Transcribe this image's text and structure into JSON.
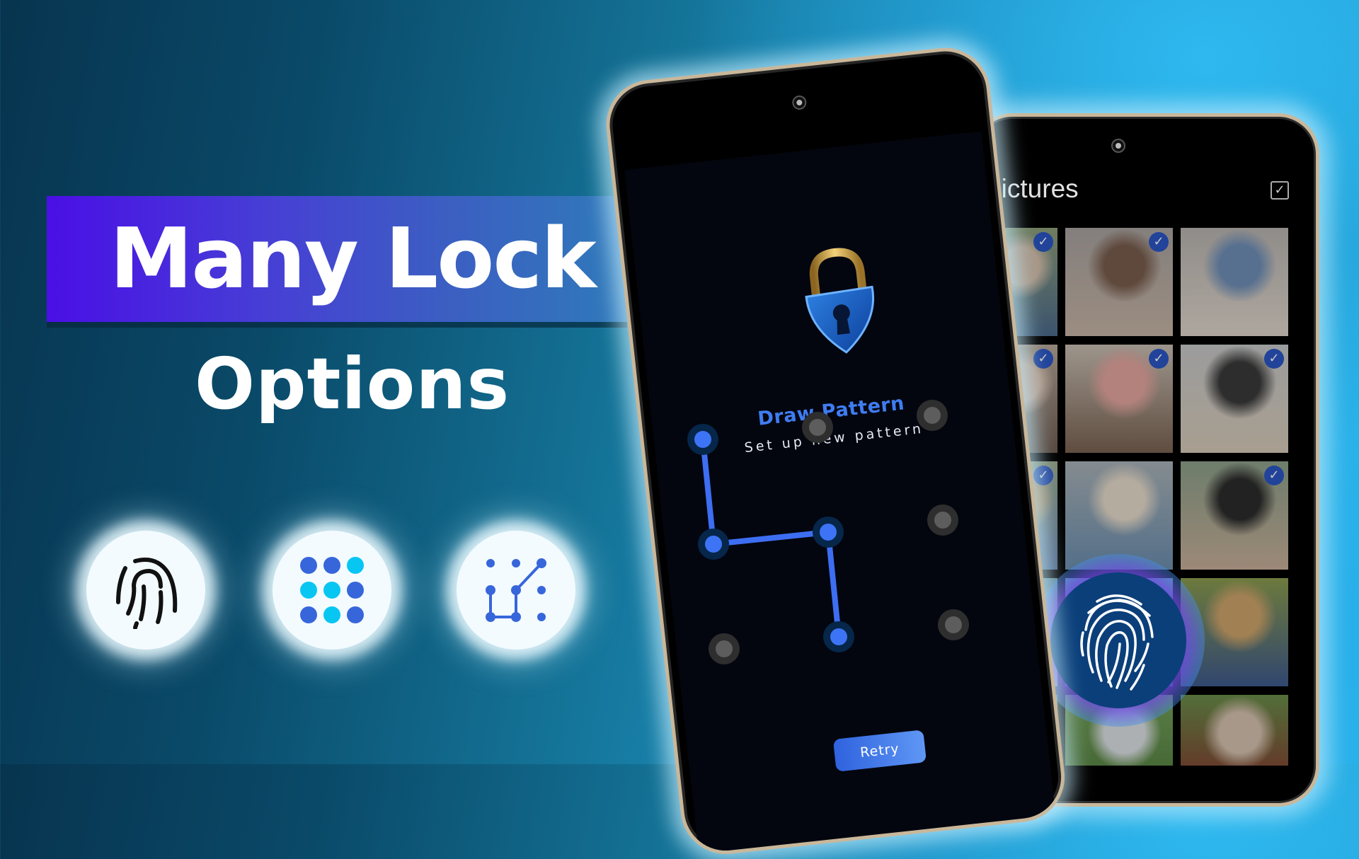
{
  "headline": {
    "line1": "Many Lock",
    "line2": "Options"
  },
  "lock_options": [
    {
      "name": "fingerprint",
      "icon": "fingerprint-icon"
    },
    {
      "name": "pin",
      "icon": "pin-keypad-icon"
    },
    {
      "name": "pattern",
      "icon": "pattern-icon"
    }
  ],
  "front_phone": {
    "screen": "pattern-setup",
    "lock_icon": "padlock-icon",
    "title": "Draw Pattern",
    "subtitle": "Set up new pattern",
    "pattern_grid": {
      "rows": 3,
      "cols": 3,
      "selected_sequence": [
        [
          0,
          0
        ],
        [
          1,
          0
        ],
        [
          1,
          1
        ],
        [
          2,
          1
        ]
      ]
    },
    "retry_label": "Retry"
  },
  "back_phone": {
    "title": "Pictures",
    "select_all_icon": "checkbox-checked-icon",
    "photos": [
      {
        "selected": true
      },
      {
        "selected": true
      },
      {
        "selected": false
      },
      {
        "selected": true
      },
      {
        "selected": true
      },
      {
        "selected": true
      },
      {
        "selected": true
      },
      {
        "selected": false
      },
      {
        "selected": true
      },
      {
        "selected": false
      },
      {
        "selected": false
      },
      {
        "selected": false
      },
      {
        "selected": false
      },
      {
        "selected": false
      },
      {
        "selected": false
      }
    ],
    "overlay_icon": "fingerprint-icon"
  },
  "colors": {
    "accent_blue": "#3f7cf2",
    "band_start": "#4a0fe6",
    "band_end": "#2f7ab9",
    "check_badge": "#2a56c6",
    "fingerprint_disc": "#0b3f7a"
  }
}
